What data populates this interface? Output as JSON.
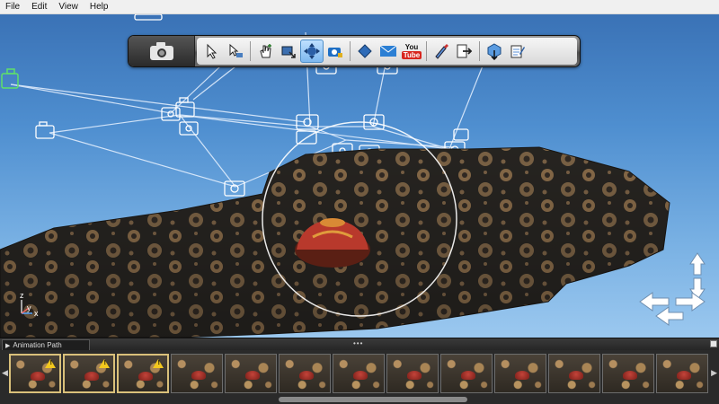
{
  "menu": {
    "items": [
      "File",
      "Edit",
      "View",
      "Help"
    ]
  },
  "toolbar": {
    "youtube_top": "You",
    "youtube_bottom": "Tube"
  },
  "animation_panel": {
    "tab_label": "Animation Path",
    "grip": "•••"
  },
  "colors": {
    "sky_top": "#3a72b6",
    "sky_bottom": "#9bc8ef",
    "accent_active": "#7db8ef",
    "warning": "#f3c81e"
  }
}
